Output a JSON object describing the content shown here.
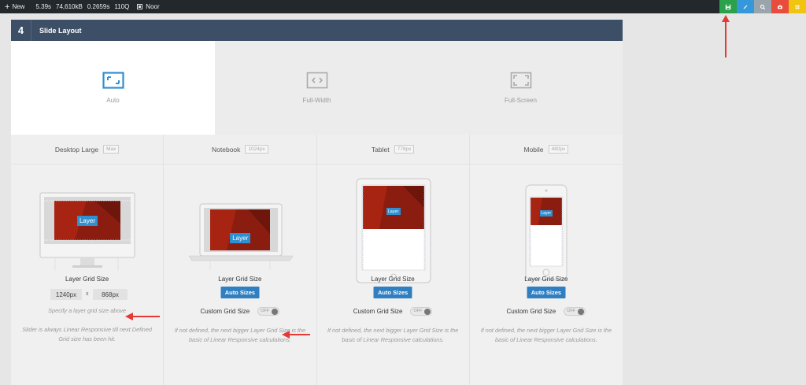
{
  "topbar": {
    "new_label": "New",
    "stats": [
      "5.39s",
      "74,610kB",
      "0.2659s",
      "110Q"
    ],
    "user": "Noor",
    "buttons": [
      {
        "icon": "save-icon",
        "color": "#2aa14a"
      },
      {
        "icon": "pencil-icon",
        "color": "#3498db"
      },
      {
        "icon": "search-icon",
        "color": "#9aa4ab"
      },
      {
        "icon": "camera-icon",
        "color": "#e74c3c"
      },
      {
        "icon": "grid-icon",
        "color": "#f1c40f"
      }
    ]
  },
  "panel": {
    "number": "4",
    "title": "Slide Layout",
    "header_color": "#3d4f66",
    "layouts": [
      {
        "label": "Auto",
        "icon": "auto-layout-icon",
        "active": true
      },
      {
        "label": "Full-Width",
        "icon": "full-width-icon",
        "active": false
      },
      {
        "label": "Full-Screen",
        "icon": "full-screen-icon",
        "active": false
      }
    ],
    "devices": {
      "desktop": {
        "name": "Desktop Large",
        "badge": "Max",
        "grid_label": "Layer Grid Size",
        "width_value": "1240px",
        "height_value": "868px",
        "separator": "x",
        "hint": "Specify a layer grid size above",
        "note": "Slider is always Linear Responsive till next Defined Grid size has been hit.",
        "layer_label": "Layer"
      },
      "notebook": {
        "name": "Notebook",
        "badge": "1024px",
        "grid_label": "Layer Grid Size",
        "auto_button": "Auto Sizes",
        "custom_label": "Custom Grid Size",
        "toggle_text": "OFF",
        "note": "If not defined, the next bigger Layer Grid Size is the basic of Linear Responsive calculations.",
        "layer_label": "Layer"
      },
      "tablet": {
        "name": "Tablet",
        "badge": "778px",
        "grid_label": "Layer Grid Size",
        "auto_button": "Auto Sizes",
        "custom_label": "Custom Grid Size",
        "toggle_text": "OFF",
        "note": "If not defined, the next bigger Layer Grid Size is the basic of Linear Responsive calculations.",
        "layer_label": "Layer"
      },
      "mobile": {
        "name": "Mobile",
        "badge": "480px",
        "grid_label": "Layer Grid Size",
        "auto_button": "Auto Sizes",
        "custom_label": "Custom Grid Size",
        "toggle_text": "OFF",
        "note": "If not defined, the next bigger Layer Grid Size is the basic of Linear Responsive calculations.",
        "layer_label": "Layer"
      }
    }
  },
  "colors": {
    "accent_blue": "#2f7fc1",
    "arrow_red": "#e53935"
  }
}
